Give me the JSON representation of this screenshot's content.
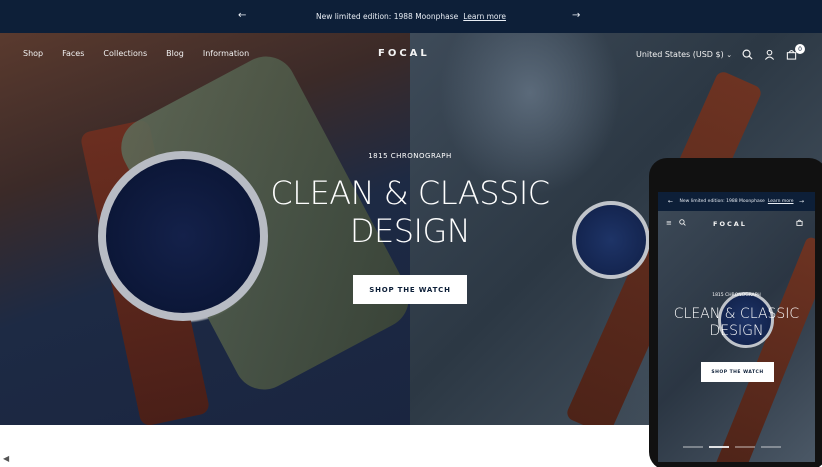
{
  "announcement": {
    "text": "New limited edition: 1988 Moonphase",
    "link": "Learn more",
    "prev_icon": "arrow-left-icon",
    "next_icon": "arrow-right-icon"
  },
  "nav": {
    "links": [
      "Shop",
      "Faces",
      "Collections",
      "Blog",
      "Information"
    ],
    "logo": "FOCAL",
    "currency": "United States (USD $)",
    "cart_count": "0"
  },
  "hero": {
    "eyebrow": "1815 CHRONOGRAPH",
    "headline_line1": "CLEAN & CLASSIC",
    "headline_line2": "DESIGN",
    "cta": "SHOP THE WATCH"
  },
  "phone": {
    "announcement_text": "New limited edition: 1988 Moonphase",
    "announcement_link": "Learn more",
    "logo": "FOCAL",
    "eyebrow": "1815 CHRONOGRAPH",
    "headline_line1": "CLEAN & CLASSIC",
    "headline_line2": "DESIGN",
    "cta": "SHOP THE WATCH"
  },
  "colors": {
    "navy": "#0d1f38",
    "white": "#ffffff"
  }
}
